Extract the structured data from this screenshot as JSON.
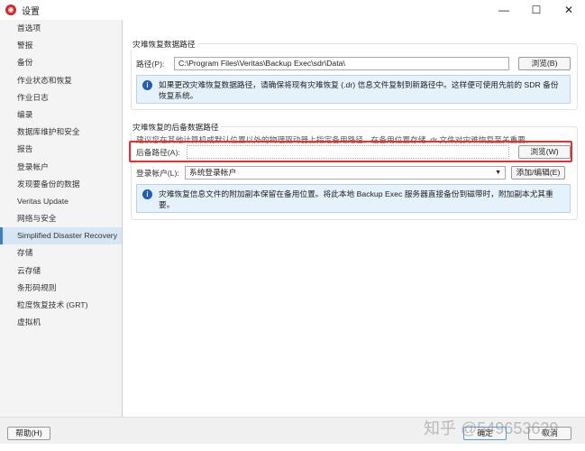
{
  "window": {
    "title": "设置",
    "minimize": "—",
    "maximize": "☐",
    "close": "✕"
  },
  "sidebar": {
    "items": [
      "首选项",
      "警报",
      "备份",
      "作业状态和恢复",
      "作业日志",
      "编录",
      "数据库维护和安全",
      "报告",
      "登录帐户",
      "发现要备份的数据",
      "Veritas Update",
      "网络与安全",
      "Simplified Disaster Recovery",
      "存储",
      "云存储",
      "条形码规则",
      "粒度恢复技术 (GRT)",
      "虚拟机"
    ],
    "selected": 12
  },
  "group1": {
    "title": "灾难恢复数据路径",
    "path_label": "路径(P):",
    "path_value": "C:\\Program Files\\Veritas\\Backup Exec\\sdr\\Data\\",
    "browse": "浏览(B)",
    "info": "如果更改灾难恢复数据路径，请确保将现有灾难恢复 (.dr) 信息文件复制到新路径中。这样便可使用先前的 SDR 备份恢复系统。"
  },
  "group2": {
    "title": "灾难恢复的后备数据路径",
    "description": "建议您在其他计算机或默认位置以外的物理驱动器上指定备用路径。在备用位置存储 .dr 文件对灾难恢复至关重要。",
    "alt_label": "后备路径(A):",
    "alt_value": "",
    "browse": "浏览(W)",
    "account_label": "登录帐户(L):",
    "account_value": "系统登录帐户",
    "add_edit": "添加/编辑(E)",
    "info": "灾难恢复信息文件的附加副本保留在备用位置。将此本地 Backup Exec 服务器直接备份到磁带时，附加副本尤其重要。"
  },
  "footer": {
    "help": "帮助(H)",
    "ok": "确定",
    "cancel": "取消"
  },
  "watermark": "知乎 @549653629"
}
